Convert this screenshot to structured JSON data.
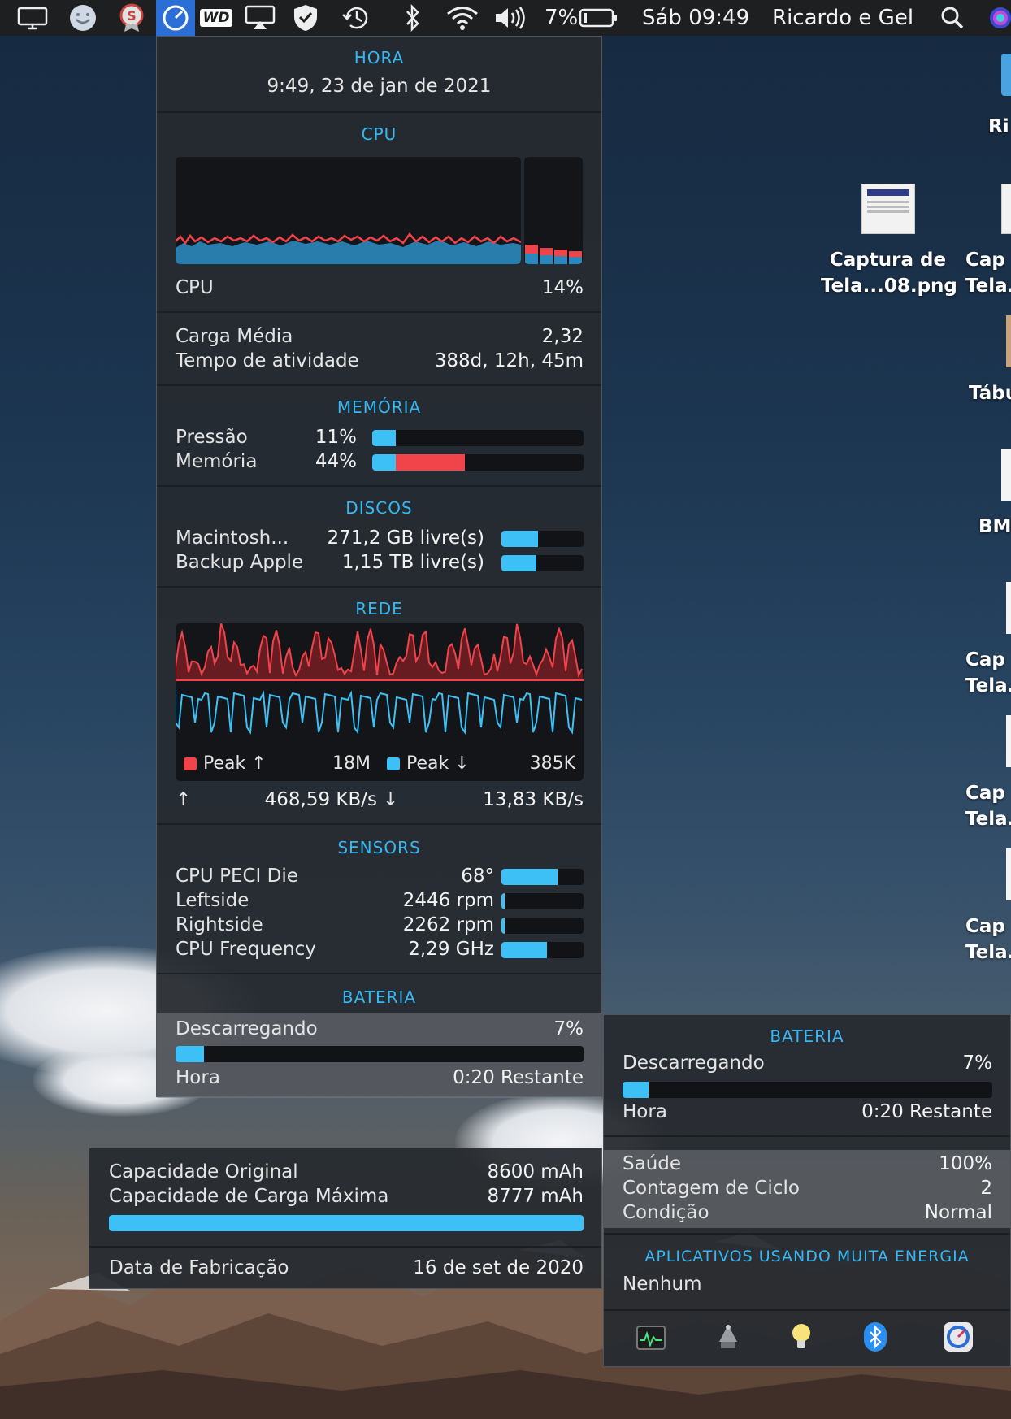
{
  "menubar": {
    "battery_percent": "7%",
    "clock": "Sáb 09:49",
    "user": "Ricardo e Gel",
    "wd_label": "WD",
    "icons": [
      "display-icon",
      "face-icon",
      "badge-icon",
      "istat-icon",
      "wd-icon",
      "airplay-icon",
      "shield-icon",
      "time-machine-icon",
      "bluetooth-icon",
      "wifi-icon",
      "volume-icon",
      "battery-icon",
      "search-icon",
      "siri-icon"
    ]
  },
  "hora": {
    "title": "HORA",
    "datetime": "9:49, 23 de jan de 2021"
  },
  "cpu": {
    "title": "CPU",
    "label": "CPU",
    "value": "14%",
    "user_bars": [
      0.12,
      0.1,
      0.09,
      0.08
    ]
  },
  "load": {
    "load_label": "Carga Média",
    "load_value": "2,32",
    "uptime_label": "Tempo de atividade",
    "uptime_value": "388d, 12h, 45m"
  },
  "memory": {
    "title": "MEMÓRIA",
    "pressure_label": "Pressão",
    "pressure_value": "11%",
    "pressure_frac": 0.11,
    "memory_label": "Memória",
    "memory_value": "44%",
    "memory_frac": 0.44,
    "memory_red_frac": 0.33
  },
  "disks": {
    "title": "DISCOS",
    "items": [
      {
        "name": "Macintosh...",
        "free": "271,2 GB livre(s)",
        "used_frac": 0.45
      },
      {
        "name": "Backup Apple",
        "free": "1,15 TB livre(s)",
        "used_frac": 0.43
      }
    ]
  },
  "network": {
    "title": "REDE",
    "peak_up_label": "Peak ↑",
    "peak_up_value": "18M",
    "peak_down_label": "Peak ↓",
    "peak_down_value": "385K",
    "up_arrow": "↑",
    "up_rate": "468,59 KB/s",
    "down_arrow": "↓",
    "down_rate": "13,83 KB/s"
  },
  "sensors": {
    "title": "SENSORS",
    "items": [
      {
        "label": "CPU PECI Die",
        "value": "68°",
        "frac": 0.68
      },
      {
        "label": "Leftside",
        "value": "2446 rpm",
        "frac": 0.04
      },
      {
        "label": "Rightside",
        "value": "2262 rpm",
        "frac": 0.04
      },
      {
        "label": "CPU Frequency",
        "value": "2,29 GHz",
        "frac": 0.55
      }
    ]
  },
  "battery_main": {
    "title": "BATERIA",
    "status_label": "Descarregando",
    "percent": "7%",
    "frac": 0.07,
    "time_label": "Hora",
    "time_value": "0:20 Restante"
  },
  "battery_detail": {
    "original_label": "Capacidade Original",
    "original_value": "8600 mAh",
    "max_label": "Capacidade de Carga Máxima",
    "max_value": "8777 mAh",
    "frac": 1.0,
    "date_label": "Data de Fabricação",
    "date_value": "16 de set de 2020"
  },
  "battery_right": {
    "title": "BATERIA",
    "status_label": "Descarregando",
    "percent": "7%",
    "frac": 0.07,
    "time_label": "Hora",
    "time_value": "0:20 Restante",
    "health_label": "Saúde",
    "health_value": "100%",
    "cycle_label": "Contagem de Ciclo",
    "cycle_value": "2",
    "condition_label": "Condição",
    "condition_value": "Normal",
    "apps_title": "APLICATIVOS USANDO MUITA ENERGIA",
    "apps_value": "Nenhum",
    "tool_icons": [
      "activity-monitor-icon",
      "system-info-icon",
      "bulb-icon",
      "bluetooth-app-icon",
      "istat-app-icon"
    ]
  },
  "desktop": {
    "icons": [
      {
        "label1": "Ri",
        "label2": ""
      },
      {
        "label1": "Captura de",
        "label2": "Tela...08.png"
      },
      {
        "label1": "Cap",
        "label2": "Tela."
      },
      {
        "label1": "Tábu",
        "label2": ""
      },
      {
        "label1": "BM",
        "label2": ""
      },
      {
        "label1": "Cap",
        "label2": "Tela."
      },
      {
        "label1": "Cap",
        "label2": "Tela."
      },
      {
        "label1": "Cap",
        "label2": "Tela."
      }
    ]
  }
}
